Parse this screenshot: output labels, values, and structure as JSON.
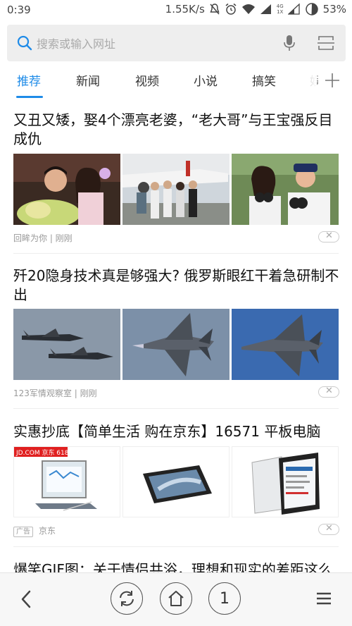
{
  "status_bar": {
    "time": "0:39",
    "net_speed": "1.55K/s",
    "net_tag_top": "4G",
    "net_tag_bottom": "1X",
    "battery": "53%",
    "icons": [
      "mute-icon",
      "alarm-icon",
      "wifi-icon",
      "signal-icon",
      "signal-icon",
      "battery-icon"
    ]
  },
  "search": {
    "placeholder": "搜索或输入网址",
    "icons": [
      "search-icon",
      "mic-icon",
      "scan-icon"
    ]
  },
  "tabs": {
    "items": [
      {
        "label": "推荐",
        "active": true
      },
      {
        "label": "新闻",
        "active": false
      },
      {
        "label": "视频",
        "active": false
      },
      {
        "label": "小说",
        "active": false
      },
      {
        "label": "搞笑",
        "active": false
      },
      {
        "label": "娱",
        "active": false
      }
    ],
    "add_icon": "plus-icon",
    "accent": "#1e8be8"
  },
  "feed": [
    {
      "title": "又丑又矮，娶4个漂亮老婆，“老大哥”与王宝强反目成仇",
      "source": "回眸为你 | 刚刚",
      "dismiss": "✕"
    },
    {
      "title": "歼20隐身技术真是够强大? 俄罗斯眼红干着急研制不出",
      "source": "123军情观察室 | 刚刚",
      "dismiss": "✕"
    },
    {
      "title": "实惠抄底【简单生活 购在京东】16571 平板电脑",
      "ad_label": "广告",
      "source": "京东",
      "thumb_brand": "JD.COM 京东 618",
      "dismiss": "✕"
    },
    {
      "title": "爆笑GIF图：关于情侣共浴，理想和现实的差距这么"
    }
  ],
  "bottom_bar": {
    "tab_count": "1",
    "icons": [
      "back-icon",
      "refresh-icon",
      "home-icon",
      "menu-icon"
    ]
  }
}
